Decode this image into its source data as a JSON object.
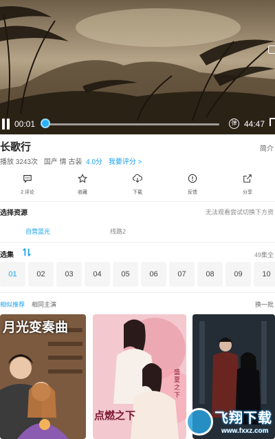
{
  "player": {
    "current_time": "00:01",
    "total_time": "44:47",
    "progress": 0.003,
    "danmu_label": "弹"
  },
  "info": {
    "title": "长歌行",
    "intro_label": "简介",
    "play_count": "播放 3243次",
    "tags": "国产 情 古装",
    "score": "4.0分",
    "rate_label": "我要评分 >"
  },
  "actions": [
    {
      "label": "2 评论",
      "icon": "comment-icon"
    },
    {
      "label": "收藏",
      "icon": "star-icon"
    },
    {
      "label": "下载",
      "icon": "download-icon"
    },
    {
      "label": "反馈",
      "icon": "feedback-icon"
    },
    {
      "label": "分享",
      "icon": "share-icon"
    }
  ],
  "sources": {
    "title": "选择资源",
    "tip": "无法观看尝试切换下方资",
    "items": [
      "自营蓝光",
      "线路2"
    ],
    "active": 0
  },
  "episodes": {
    "title": "选集",
    "count": "49集全",
    "items": [
      "01",
      "02",
      "03",
      "04",
      "05",
      "06",
      "07",
      "08",
      "09",
      "10"
    ],
    "active": 0
  },
  "recommend": {
    "tabs": [
      "相似推荐",
      "相同主演"
    ],
    "more": "换一批",
    "posters": [
      {
        "title": "月光变奏曲"
      },
      {
        "title": "点燃之下",
        "subtitle": "盛夏之下"
      },
      {
        "title": ""
      }
    ]
  },
  "watermark": {
    "text": "飞翔下载",
    "domain": "www.fxxz.com"
  },
  "colors": {
    "accent": "#1aa3f0",
    "progress_thumb": "#2ab0ff"
  }
}
